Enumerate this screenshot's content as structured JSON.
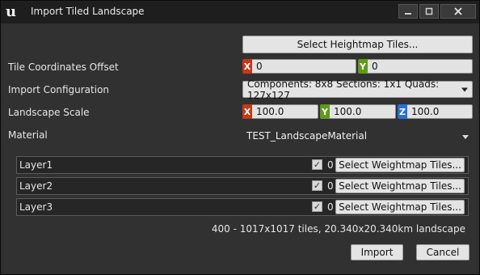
{
  "window": {
    "title": "Import Tiled Landscape",
    "logo_icon": "unreal-logo-icon",
    "controls": [
      "minimize-icon",
      "maximize-icon",
      "close-icon"
    ]
  },
  "heightmap": {
    "button_label": "Select Heightmap Tiles..."
  },
  "tile_offset": {
    "label": "Tile Coordinates Offset",
    "x": "0",
    "y": "0"
  },
  "import_config": {
    "label": "Import Configuration",
    "value": "Components: 8x8 Sections: 1x1 Quads: 127x127"
  },
  "landscape_scale": {
    "label": "Landscape Scale",
    "x": "100.0",
    "y": "100.0",
    "z": "100.0"
  },
  "material": {
    "label": "Material",
    "value": "TEST_LandscapeMaterial"
  },
  "axes": {
    "x": "X",
    "y": "Y",
    "z": "Z"
  },
  "layers": [
    {
      "name": "Layer1",
      "checked": true,
      "count": "0",
      "button_label": "Select Weightmap Tiles..."
    },
    {
      "name": "Layer2",
      "checked": true,
      "count": "0",
      "button_label": "Select Weightmap Tiles..."
    },
    {
      "name": "Layer3",
      "checked": true,
      "count": "0",
      "button_label": "Select Weightmap Tiles..."
    }
  ],
  "summary": "400 - 1017x1017 tiles, 20.340x20.340km landscape",
  "footer": {
    "import_label": "Import",
    "cancel_label": "Cancel"
  },
  "colors": {
    "axis_x": "#c4391a",
    "axis_y": "#5e9b1a",
    "axis_z": "#2a6fd6"
  }
}
